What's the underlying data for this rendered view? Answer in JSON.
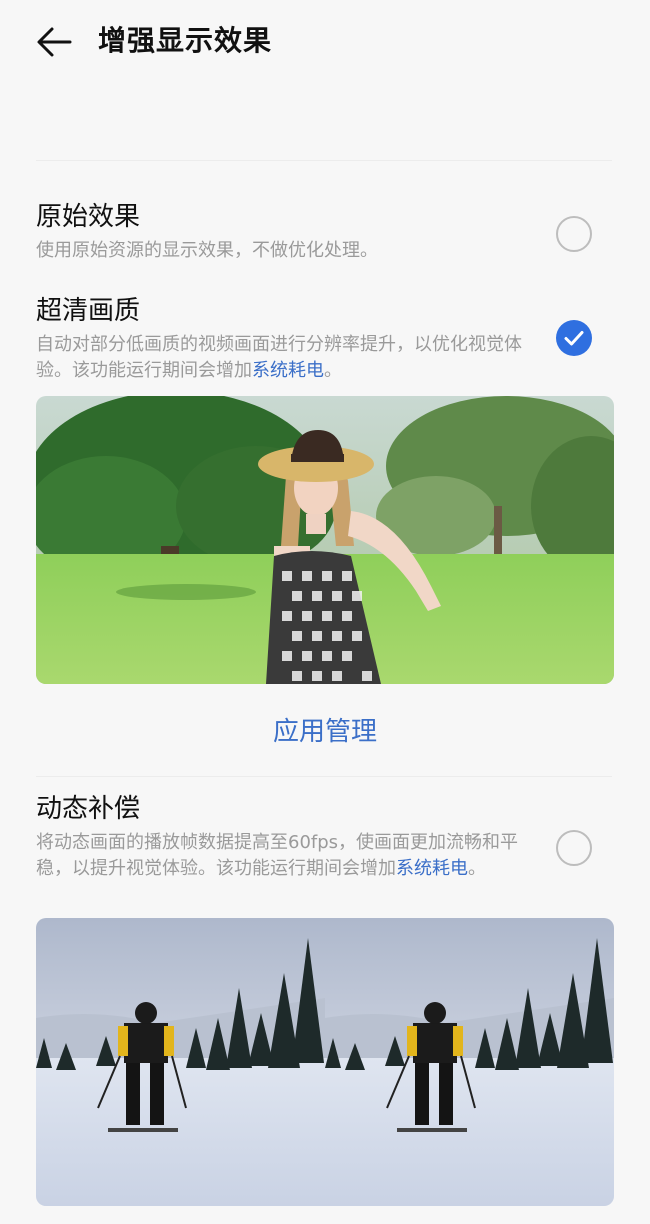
{
  "header": {
    "title": "增强显示效果"
  },
  "options": [
    {
      "title": "原始效果",
      "desc": "使用原始资源的显示效果，不做优化处理。",
      "checked": false
    },
    {
      "title": "超清画质",
      "desc_main": "自动对部分低画质的视频画面进行分辨率提升，以优化视觉体验。该功能运行期间会增加",
      "desc_link": "系统耗电",
      "desc_end": "。",
      "checked": true
    },
    {
      "title": "动态补偿",
      "desc_main": "将动态画面的播放帧数据提高至60fps，使画面更加流畅和平稳，以提升视觉体验。该功能运行期间会增加",
      "desc_link": "系统耗电",
      "desc_end": "。",
      "checked": false
    }
  ],
  "manage_link": "应用管理",
  "icons": {
    "back": "back-arrow-icon",
    "check": "checkmark-icon"
  },
  "colors": {
    "accent": "#2f6fe0",
    "link": "#3b6fc8",
    "secondary_text": "#9a9a9a",
    "background": "#f7f7f7"
  }
}
